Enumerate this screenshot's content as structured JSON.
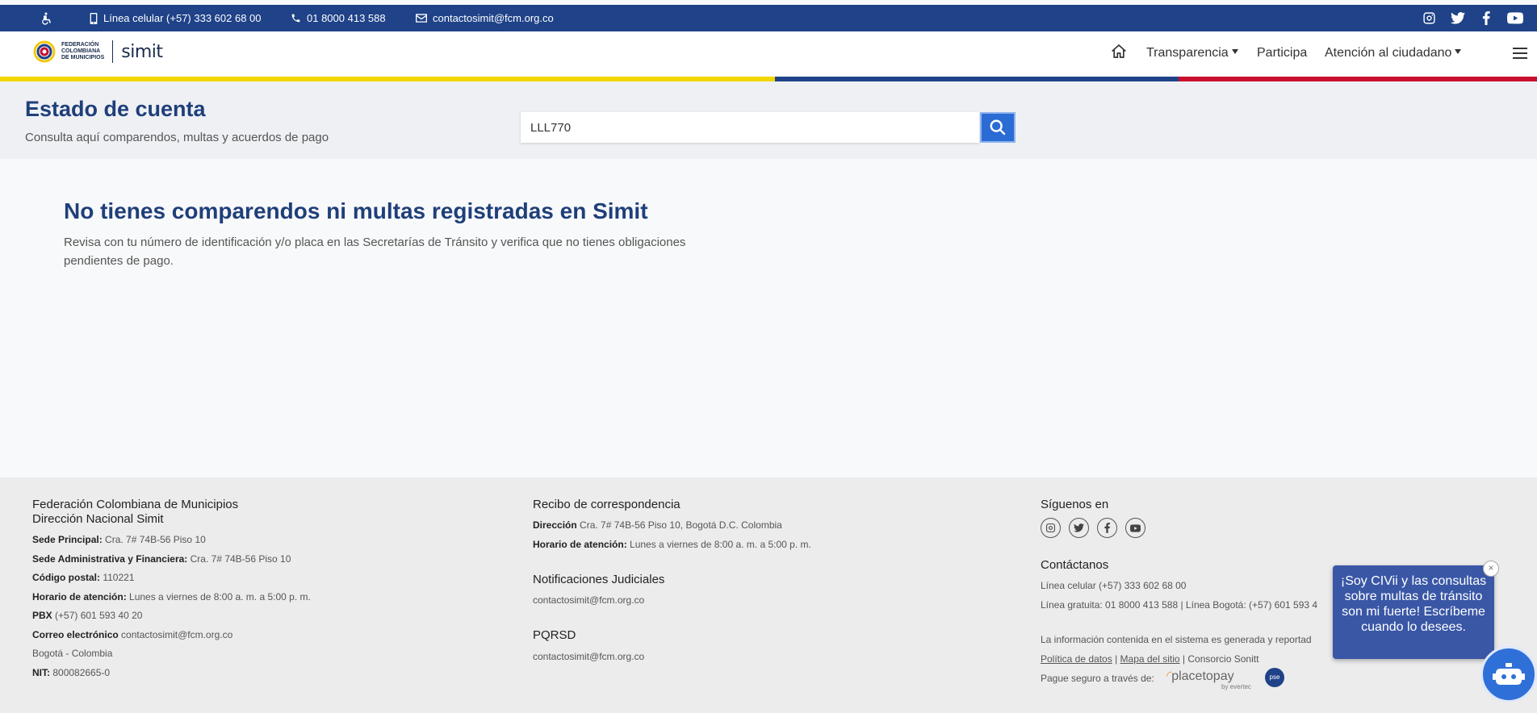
{
  "topbar": {
    "phone_mobile": "Línea celular (+57) 333 602 68 00",
    "phone_free": "01 8000 413 588",
    "email": "contactosimit@fcm.org.co",
    "social_icons": [
      "instagram-icon",
      "twitter-icon",
      "facebook-icon",
      "youtube-icon"
    ]
  },
  "brand": {
    "logo_lines": [
      "FEDERACIÓN",
      "COLOMBIANA",
      "DE MUNICIPIOS"
    ],
    "name": "simit"
  },
  "nav": {
    "transparencia": "Transparencia",
    "participa": "Participa",
    "atencion": "Atención al ciudadano"
  },
  "colors": {
    "primary": "#1f4288",
    "yellow": "#f2c811",
    "blue": "#1f4288",
    "red": "#c8102e",
    "button": "#2b6cd4"
  },
  "hero": {
    "title": "Estado de cuenta",
    "subtitle": "Consulta aquí comparendos, multas y acuerdos de pago",
    "search_value": "LLL770"
  },
  "result": {
    "title": "No tienes comparendos ni multas registradas en Simit",
    "text": "Revisa con tu número de identificación y/o placa en las Secretarías de Tránsito y verifica que no tienes obligaciones pendientes de pago."
  },
  "footer": {
    "col1": {
      "title1": "Federación Colombiana de Municipios",
      "title2": "Dirección Nacional Simit",
      "rows": [
        {
          "label": "Sede Principal:",
          "value": "Cra. 7# 74B-56 Piso 10"
        },
        {
          "label": "Sede Administrativa y Financiera:",
          "value": "Cra. 7# 74B-56 Piso 10"
        },
        {
          "label": "Código postal:",
          "value": "110221"
        },
        {
          "label": "Horario de atención:",
          "value": "Lunes a viernes de 8:00 a. m. a 5:00 p. m."
        },
        {
          "label": "PBX",
          "value": "(+57) 601 593 40 20"
        },
        {
          "label": "Correo electrónico",
          "value": "contactosimit@fcm.org.co"
        },
        {
          "label": "",
          "value": "Bogotá - Colombia"
        },
        {
          "label": "NIT:",
          "value": "800082665-0"
        }
      ]
    },
    "col2": {
      "title": "Recibo de correspondencia",
      "dir_label": "Dirección",
      "dir_value": "Cra. 7# 74B-56 Piso 10, Bogotá D.C. Colombia",
      "hor_label": "Horario de atención:",
      "hor_value": "Lunes a viernes de 8:00 a. m. a 5:00 p. m.",
      "notif_title": "Notificaciones Judiciales",
      "notif_email": "contactosimit@fcm.org.co",
      "pqrsd_title": "PQRSD",
      "pqrsd_email": "contactosimit@fcm.org.co"
    },
    "col3": {
      "follow_title": "Síguenos en",
      "contact_title": "Contáctanos",
      "mobile": "Línea celular (+57) 333 602 68 00",
      "free": "Línea gratuita: 01 8000 413 588 | Línea Bogotá: (+57) 601 593 4",
      "info": "La información contenida en el sistema es generada y reportad",
      "policy": "Política de datos",
      "sitemap": "Mapa del sitio",
      "consortium": "Consorcio Sonitt",
      "pay": "Pague seguro a través de:",
      "placetopay": "placetopay",
      "evertec": "by evertec",
      "pse": "pse"
    }
  },
  "chat": {
    "message": "¡Soy CIVii y las consultas sobre multas de tránsito son mi fuerte! Escríbeme cuando lo desees.",
    "close": "×"
  }
}
